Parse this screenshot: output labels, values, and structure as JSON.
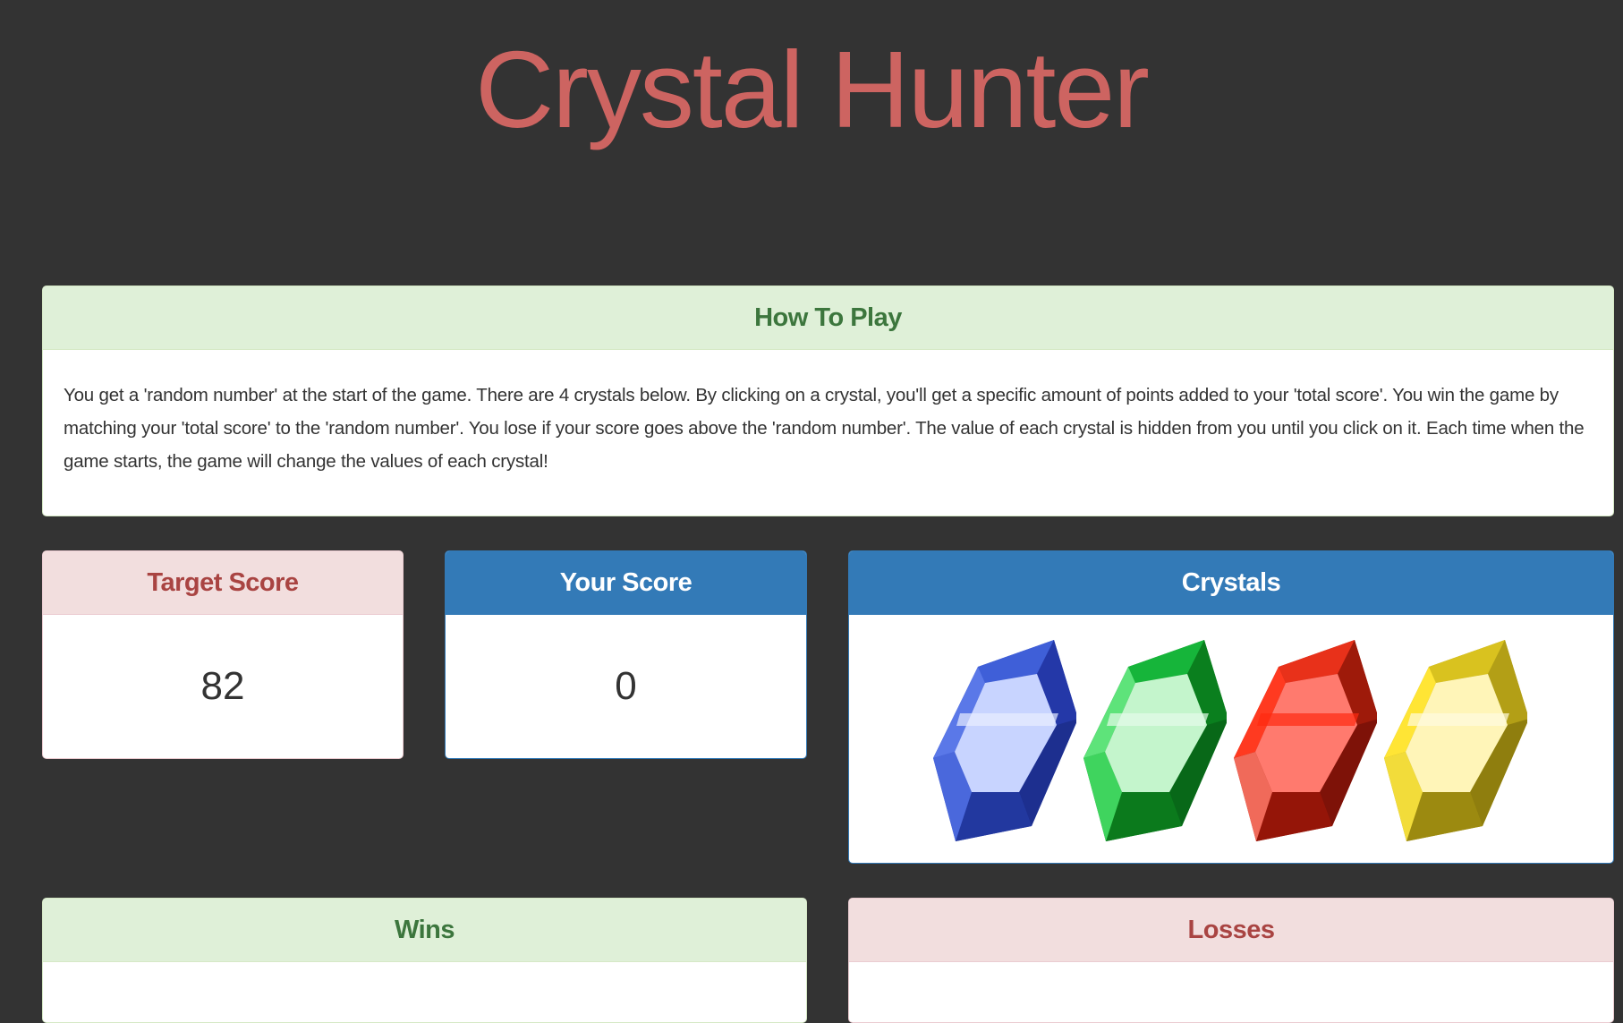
{
  "title": "Crystal Hunter",
  "how_to_play": {
    "heading": "How To Play",
    "text": "You get a 'random number' at the start of the game. There are 4 crystals below. By clicking on a crystal, you'll get a specific amount of points added to your 'total score'. You win the game by matching your 'total score' to the 'random number'. You lose if your score goes above the 'random number'. The value of each crystal is hidden from you until you click on it. Each time when the game starts, the game will change the values of each crystal!"
  },
  "target_score": {
    "heading": "Target Score",
    "value": "82"
  },
  "your_score": {
    "heading": "Your Score",
    "value": "0"
  },
  "crystals": {
    "heading": "Crystals",
    "items": [
      {
        "name": "blue-crystal-icon",
        "color": "#3a55c8"
      },
      {
        "name": "green-crystal-icon",
        "color": "#1aa832"
      },
      {
        "name": "red-crystal-icon",
        "color": "#d42a14"
      },
      {
        "name": "yellow-crystal-icon",
        "color": "#d9c21f"
      }
    ]
  },
  "wins": {
    "heading": "Wins"
  },
  "losses": {
    "heading": "Losses"
  }
}
